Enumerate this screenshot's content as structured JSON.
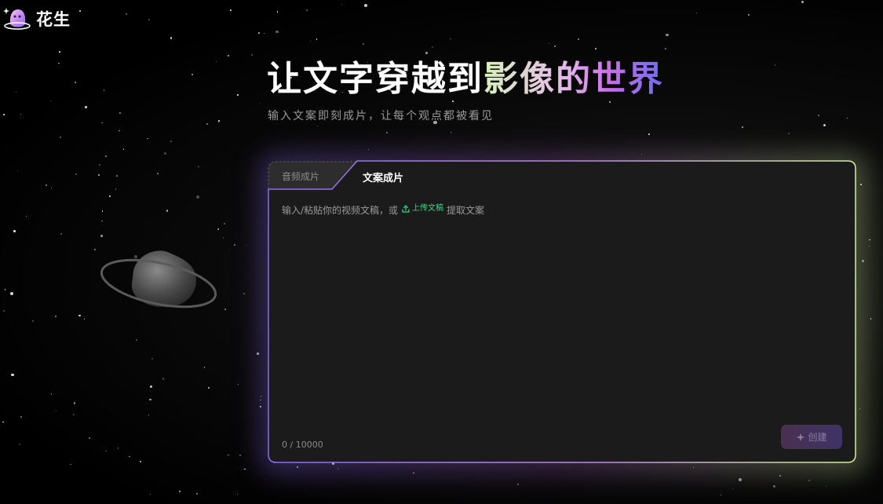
{
  "brand": {
    "name": "花生",
    "logo_icon": "ghost-logo-icon"
  },
  "hero": {
    "title_plain": "让文字穿越到",
    "title_highlight": "影像的世界",
    "subtitle": "输入文案即刻成片，让每个观点都被看见"
  },
  "editor": {
    "tabs": [
      {
        "label": "音频成片",
        "active": false
      },
      {
        "label": "文案成片",
        "active": true
      }
    ],
    "placeholder_before": "输入/粘贴你的视频文稿，或",
    "upload_label": "上传文稿",
    "upload_icon": "upload-icon",
    "placeholder_after": "提取文案",
    "counter": "0 / 10000",
    "create_label": "创建",
    "create_icon": "sparkle-icon"
  },
  "colors": {
    "upload_accent": "#3ed68a",
    "card_border_start": "#8a6cf0",
    "card_border_end": "#d3ef9e",
    "title_gradient_start": "#d8f2b9",
    "title_gradient_end": "#6e6bf5"
  }
}
